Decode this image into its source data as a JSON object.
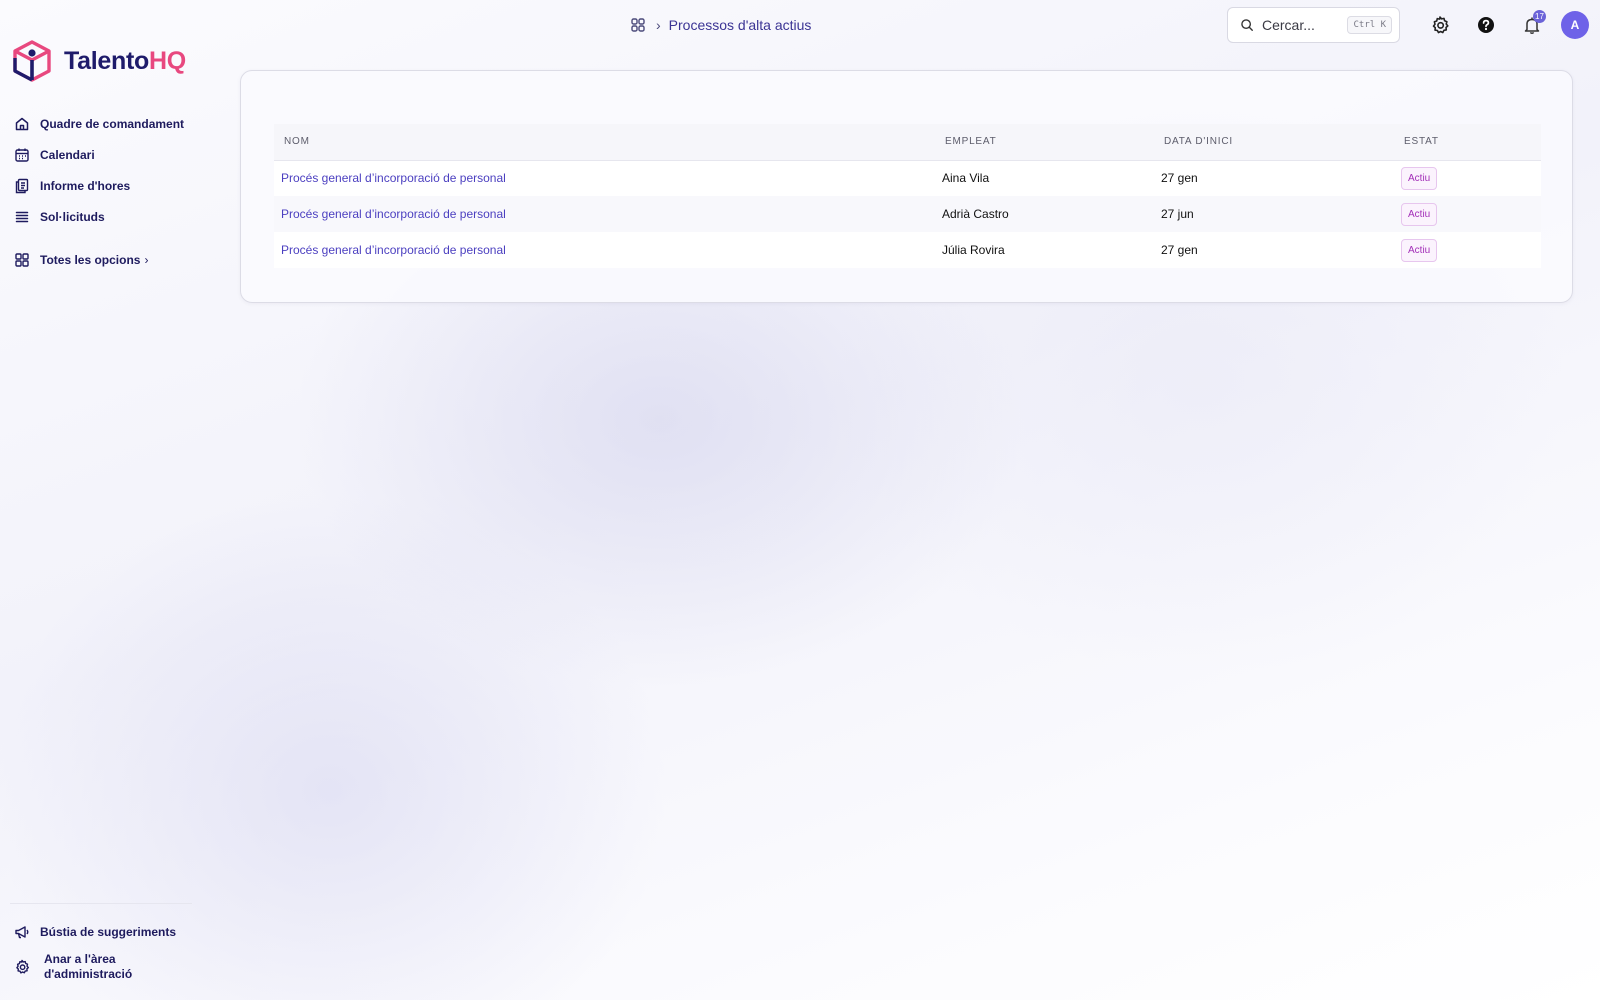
{
  "brand": {
    "name_part1": "Talento",
    "name_part2": "HQ",
    "color_primary": "#1e1b6b",
    "color_accent": "#e8487f"
  },
  "sidebar": {
    "items": [
      {
        "icon": "home-icon",
        "label": "Quadre de comandament"
      },
      {
        "icon": "calendar-icon",
        "label": "Calendari"
      },
      {
        "icon": "documents-icon",
        "label": "Informe d'hores"
      },
      {
        "icon": "list-icon",
        "label": "Sol·licituds"
      }
    ],
    "all_options": {
      "icon": "grid-icon",
      "label": "Totes les opcions",
      "chevron": "›"
    },
    "bottom": [
      {
        "icon": "megaphone-icon",
        "label": "Bústia de suggeriments"
      },
      {
        "icon": "gear-icon",
        "label_line1": "Anar a l'àrea",
        "label_line2": "d'administració"
      }
    ]
  },
  "header": {
    "breadcrumb_icon": "grid-icon",
    "breadcrumb_separator": "›",
    "title": "Processos d'alta actius",
    "search": {
      "placeholder": "Cercar...",
      "shortcut": "Ctrl K"
    },
    "notifications_count": "17",
    "avatar_initial": "A"
  },
  "table": {
    "columns": [
      "Nom",
      "Empleat",
      "Data d'inici",
      "Estat"
    ],
    "rows": [
      {
        "name": "Procés general d’incorporació de personal",
        "employee": "Aina Vila",
        "start_date": "27 gen",
        "status": "Actiu"
      },
      {
        "name": "Procés general d’incorporació de personal",
        "employee": "Adrià Castro",
        "start_date": "27 jun",
        "status": "Actiu"
      },
      {
        "name": "Procés general d’incorporació de personal",
        "employee": "Júlia Rovira",
        "start_date": "27 gen",
        "status": "Actiu"
      }
    ]
  }
}
